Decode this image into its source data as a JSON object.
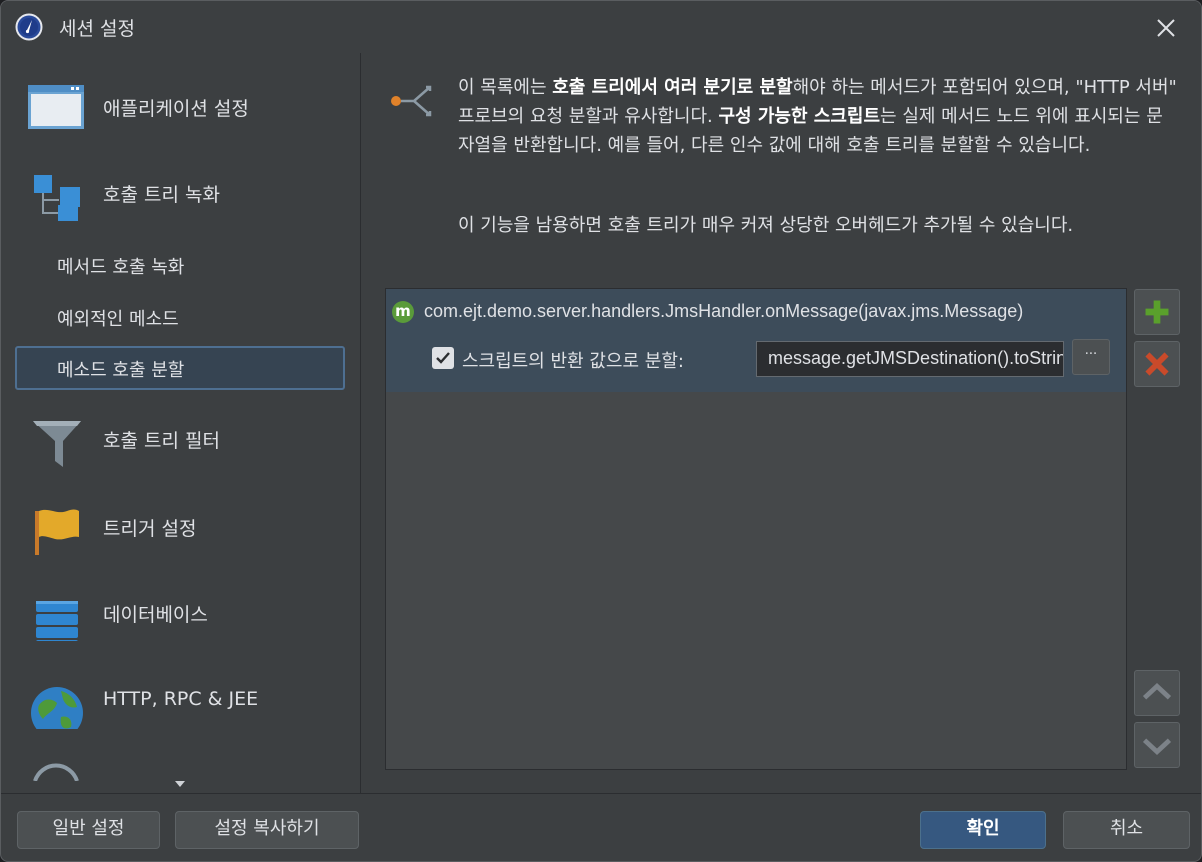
{
  "window": {
    "title": "세션 설정"
  },
  "sidebar": {
    "items": [
      {
        "label": "애플리케이션 설정",
        "icon": "window-icon"
      },
      {
        "label": "호출 트리 녹화",
        "icon": "call-tree-icon"
      },
      {
        "label": "메서드 호출 녹화"
      },
      {
        "label": "예외적인 메소드"
      },
      {
        "label": "메소드 호출 분할",
        "selected": true
      },
      {
        "label": "호출 트리 필터",
        "icon": "funnel-icon"
      },
      {
        "label": "트리거 설정",
        "icon": "flag-icon"
      },
      {
        "label": "데이터베이스",
        "icon": "database-icon"
      },
      {
        "label": "HTTP, RPC & JEE",
        "icon": "globe-icon"
      }
    ]
  },
  "content": {
    "desc_p1_a": "이 목록에는 ",
    "desc_p1_b1": "호출 트리에서 여러 분기로 분할",
    "desc_p1_c": "해야 하는 메서드가 포함되어 있으며, \"HTTP 서버\" 프로브의 요청 분할과 유사합니다. ",
    "desc_p1_b2": "구성 가능한 스크립트",
    "desc_p1_d": "는 실제 메서드 노드 위에 표시되는 문자열을 반환합니다. 예를 들어, 다른 인수 값에 대해 호출 트리를 분할할 수 있습니다.",
    "desc_p2": "이 기능을 남용하면 호출 트리가 매우 커져 상당한 오버헤드가 추가될 수 있습니다.",
    "list": {
      "method_badge": "m",
      "method": "com.ejt.demo.server.handlers.JmsHandler.onMessage(javax.jms.Message)",
      "checkbox_label": "스크립트의 반환 값으로 분할:",
      "checked": true,
      "script_value": "message.getJMSDestination().toString()",
      "ellipsis": "···"
    }
  },
  "footer": {
    "general_settings": "일반 설정",
    "copy_settings": "설정 복사하기",
    "ok": "확인",
    "cancel": "취소"
  },
  "colors": {
    "accent": "#365880",
    "selection": "#3d4c5a",
    "add": "#5aa02c",
    "remove": "#c0392b"
  }
}
